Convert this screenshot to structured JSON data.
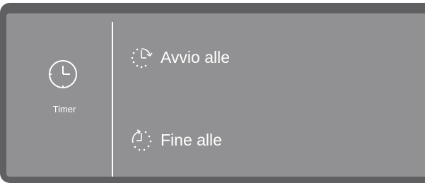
{
  "timer": {
    "icon": "clock-icon",
    "label": "Timer"
  },
  "options": [
    {
      "icon": "start-time-icon",
      "label": "Avvio alle"
    },
    {
      "icon": "end-time-icon",
      "label": "Fine alle"
    }
  ],
  "colors": {
    "frame": "#606062",
    "screen": "#919193",
    "text": "#ffffff"
  }
}
